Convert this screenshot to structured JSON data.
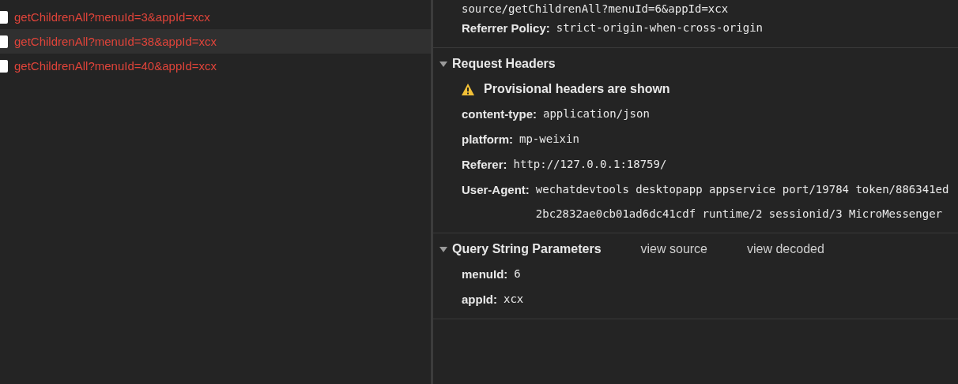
{
  "requests": [
    {
      "name": "getChildrenAll?menuId=3&appId=xcx",
      "selected": false
    },
    {
      "name": "getChildrenAll?menuId=38&appId=xcx",
      "selected": true
    },
    {
      "name": "getChildrenAll?menuId=40&appId=xcx",
      "selected": false
    }
  ],
  "general": {
    "continued_value": "source/getChildrenAll?menuId=6&appId=xcx",
    "fields": [
      {
        "key": "Referrer Policy:",
        "value": "strict-origin-when-cross-origin"
      }
    ]
  },
  "request_headers": {
    "title": "Request Headers",
    "expanded": true,
    "warning": "Provisional headers are shown",
    "fields": [
      {
        "key": "content-type:",
        "value": "application/json"
      },
      {
        "key": "platform:",
        "value": "mp-weixin"
      },
      {
        "key": "Referer:",
        "value": "http://127.0.0.1:18759/"
      },
      {
        "key": "User-Agent:",
        "value": "wechatdevtools desktopapp appservice port/19784 token/886341ed2bc2832ae0cb01ad6dc41cdf runtime/2 sessionid/3 MicroMessenger"
      }
    ]
  },
  "query": {
    "title": "Query String Parameters",
    "expanded": true,
    "links": [
      "view source",
      "view decoded"
    ],
    "fields": [
      {
        "key": "menuId:",
        "value": "6"
      },
      {
        "key": "appId:",
        "value": "xcx"
      }
    ]
  }
}
